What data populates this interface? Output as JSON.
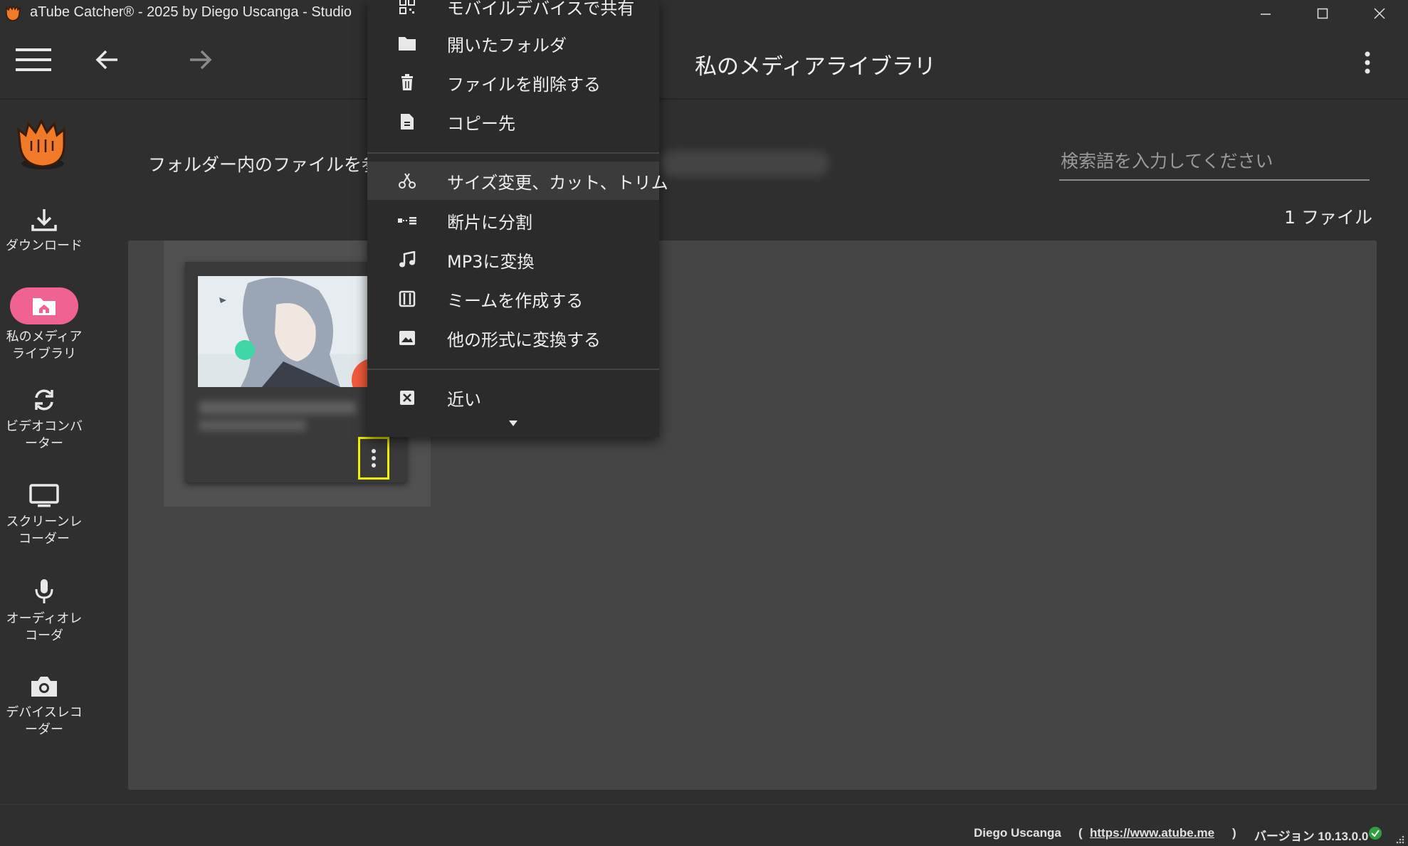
{
  "window": {
    "title": "aTube Catcher® - 2025 by Diego Uscanga - Studio",
    "icons": {
      "minimize": "minimize-icon",
      "maximize": "maximize-icon",
      "close": "close-icon"
    }
  },
  "toolbar": {
    "page_title": "私のメディアライブラリ",
    "icons": {
      "menu": "hamburger-menu-icon",
      "back": "arrow-left-icon",
      "forward": "arrow-right-icon",
      "more": "more-vertical-icon"
    }
  },
  "sidebar": {
    "items": [
      {
        "label": "ダウンロード",
        "icon": "download-icon",
        "active": false
      },
      {
        "label": "私のメディアライブラリ",
        "icon": "folder-home-icon",
        "active": true
      },
      {
        "label": "ビデオコンバーター",
        "icon": "refresh-icon",
        "active": false
      },
      {
        "label": "スクリーンレコーダー",
        "icon": "monitor-icon",
        "active": false
      },
      {
        "label": "オーディオレコーダ",
        "icon": "microphone-icon",
        "active": false
      },
      {
        "label": "デバイスレコーダー",
        "icon": "camera-icon",
        "active": false
      }
    ]
  },
  "main": {
    "browse_label": "フォルダー内のファイルを参照",
    "search_placeholder": "検索語を入力してください",
    "file_count": "1 ファイル"
  },
  "context_menu": {
    "items": [
      {
        "label": "モバイルデバイスで共有",
        "icon": "qr-code-icon"
      },
      {
        "label": "開いたフォルダ",
        "icon": "folder-icon"
      },
      {
        "label": "ファイルを削除する",
        "icon": "trash-icon"
      },
      {
        "label": "コピー先",
        "icon": "file-copy-icon"
      },
      {
        "label": "サイズ変更、カット、トリム",
        "icon": "scissors-icon",
        "highlighted": true
      },
      {
        "label": "断片に分割",
        "icon": "split-icon"
      },
      {
        "label": "MP3に変換",
        "icon": "music-note-icon"
      },
      {
        "label": "ミームを作成する",
        "icon": "meme-icon"
      },
      {
        "label": "他の形式に変換する",
        "icon": "image-icon"
      },
      {
        "label": "近い",
        "icon": "close-box-icon"
      }
    ],
    "scroll_icon": "caret-down-icon"
  },
  "footer": {
    "author": "Diego Uscanga",
    "open_paren": "(",
    "link": "https://www.atube.me",
    "close_paren": ")",
    "version": "バージョン 10.13.0.0",
    "status_icon": "check-circle-icon"
  },
  "colors": {
    "background": "#2f2f2f",
    "panel": "#454545",
    "active_pill": "#f06292",
    "highlight_border": "#f2f200",
    "status_ok": "#2e9e3e"
  }
}
